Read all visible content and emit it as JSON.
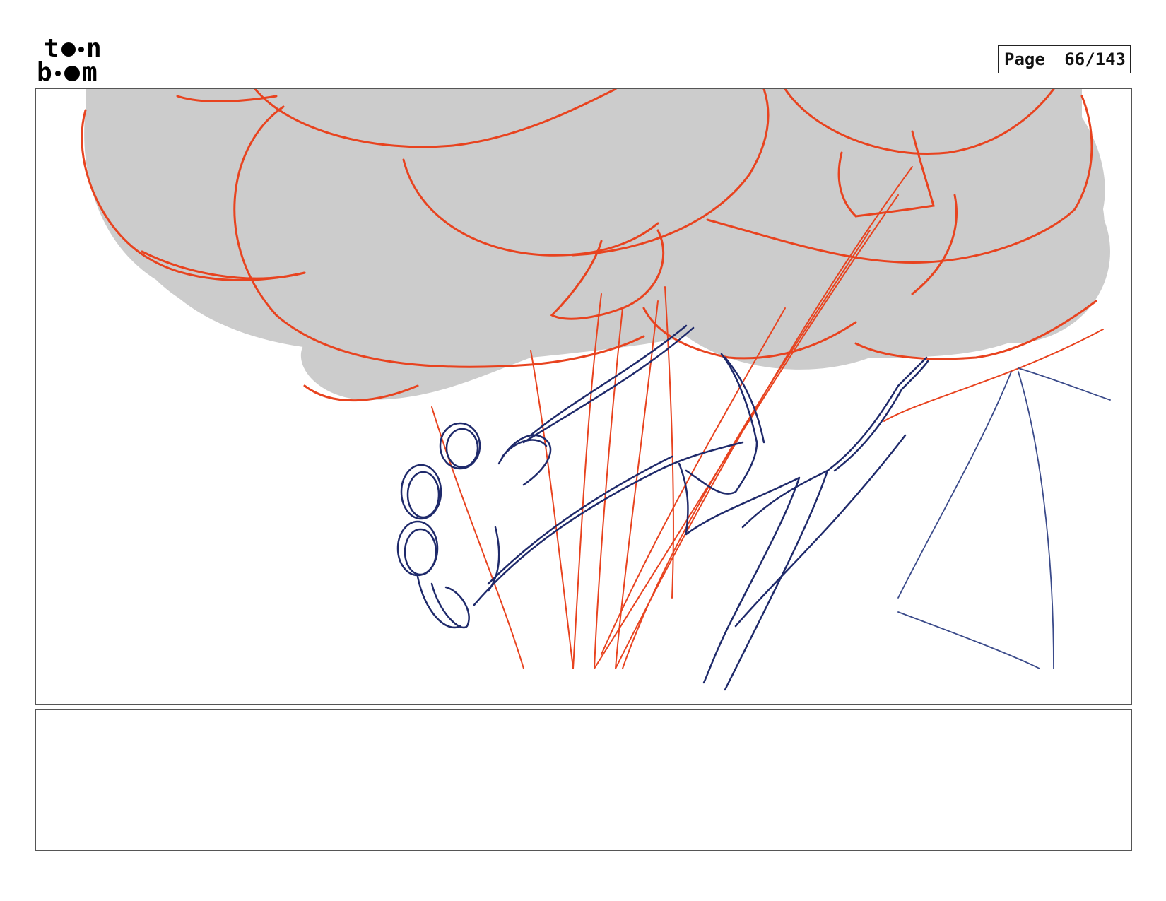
{
  "header": {
    "logo_text": "toon boom",
    "page_label": "Page",
    "page_number": "66/143"
  },
  "panel": {
    "description_colors": {
      "cloud": "#cccccc",
      "red_lines": "#e8431f",
      "blue_lines": "#1f2a6b"
    }
  },
  "notes": {
    "text": ""
  }
}
